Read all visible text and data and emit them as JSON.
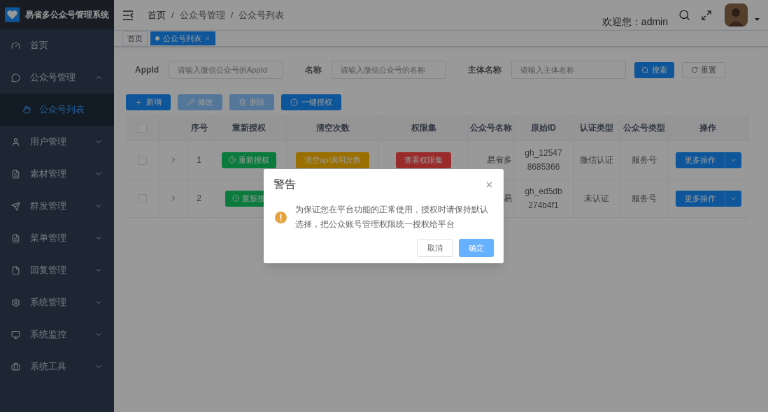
{
  "app": {
    "title": "易省多公众号管理系统"
  },
  "sidebar": {
    "items": [
      {
        "label": "首页"
      },
      {
        "label": "公众号管理",
        "expanded": true,
        "children": [
          {
            "label": "公众号列表",
            "selected": true
          }
        ]
      },
      {
        "label": "用户管理",
        "expanded": false
      },
      {
        "label": "素材管理",
        "expanded": false
      },
      {
        "label": "群发管理",
        "expanded": false
      },
      {
        "label": "菜单管理",
        "expanded": false
      },
      {
        "label": "回复管理",
        "expanded": false
      },
      {
        "label": "系统管理",
        "expanded": false
      },
      {
        "label": "系统监控",
        "expanded": false
      },
      {
        "label": "系统工具",
        "expanded": false
      }
    ]
  },
  "breadcrumb": {
    "items": [
      "首页",
      "公众号管理",
      "公众号列表"
    ],
    "separator": "/"
  },
  "user": {
    "welcome": "欢迎您：admin"
  },
  "tags": [
    {
      "label": "首页",
      "selected": false
    },
    {
      "label": "公众号列表",
      "selected": true
    }
  ],
  "search": {
    "fields": [
      {
        "label": "AppId",
        "placeholder": "请输入微信公众号的AppId"
      },
      {
        "label": "名称",
        "placeholder": "请输入微信公众号的名称"
      },
      {
        "label": "主体名称",
        "placeholder": "请输入主体名称"
      }
    ],
    "search_button": "搜索",
    "reset_button": "重置"
  },
  "toolbar": [
    {
      "label": "新增",
      "disabled": false
    },
    {
      "label": "修改",
      "disabled": true
    },
    {
      "label": "删除",
      "disabled": true
    },
    {
      "label": "一键授权",
      "disabled": false
    }
  ],
  "table": {
    "select_all_checked": false,
    "columns": [
      "序号",
      "重新授权",
      "清空次数",
      "权限集",
      "公众号名称",
      "原始ID",
      "认证类型",
      "公众号类型",
      "操作"
    ],
    "rows": [
      {
        "checked": false,
        "index": "1",
        "reauth": "重新授权",
        "clear": "清空api调用次数",
        "perm": "查看权限集",
        "name": "易省多",
        "original_id": [
          "gh_12547",
          "8685366"
        ],
        "auth_type": "微信认证",
        "account_type": "服务号",
        "action": "更多操作"
      },
      {
        "checked": false,
        "index": "2",
        "reauth": "重新授",
        "name": "易",
        "original_id": [
          "gh_ed5db",
          "274b4f1"
        ],
        "auth_type": "未认证",
        "account_type": "服务号",
        "action": "更多操作"
      }
    ]
  },
  "dialog": {
    "title": "警告",
    "message": "为保证您在平台功能的正常使用，授权时请保持默认选择，把公众账号管理权限统一授权给平台",
    "cancel": "取消",
    "confirm": "确定"
  }
}
